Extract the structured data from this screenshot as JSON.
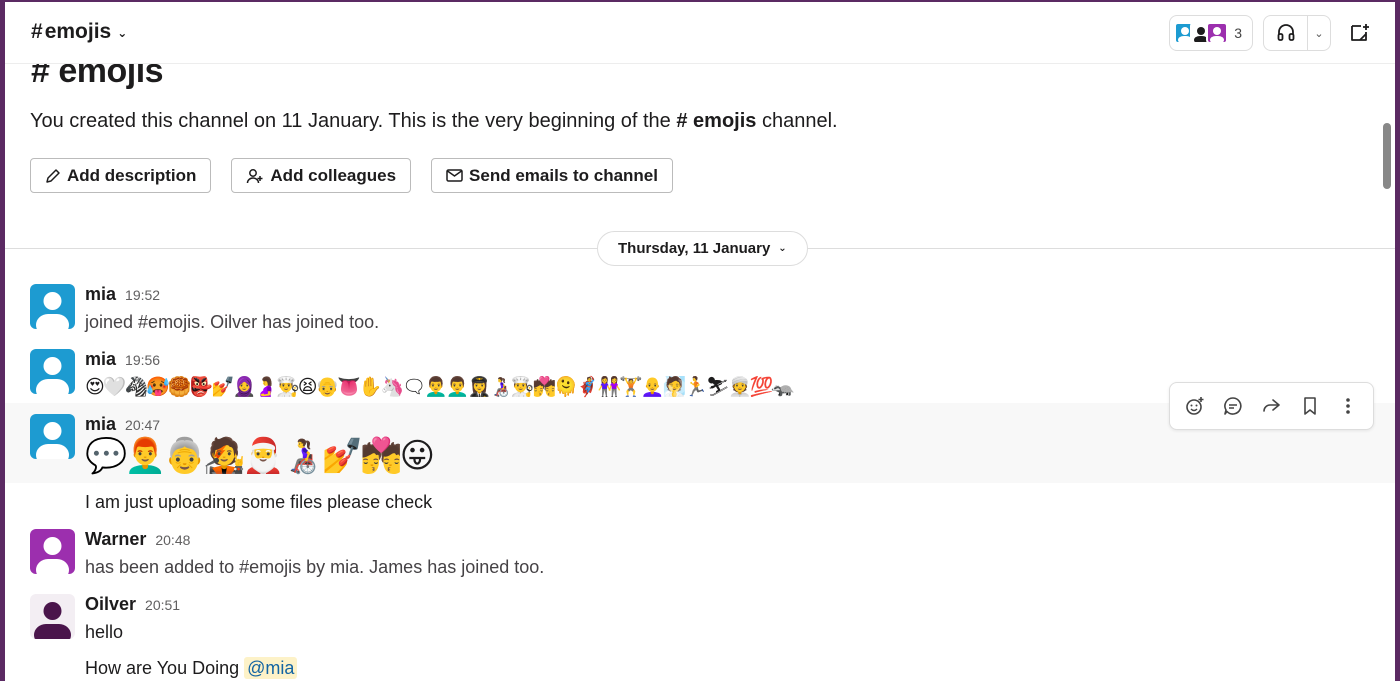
{
  "header": {
    "channel_name": "emojis",
    "hash": "#",
    "member_count": "3"
  },
  "intro": {
    "title": "emojis",
    "hash": "#",
    "text_prefix": "You created this channel on 11 January. This is the very beginning of the ",
    "text_channel": "# emojis",
    "text_suffix": " channel.",
    "buttons": {
      "add_description": "Add description",
      "add_colleagues": "Add colleagues",
      "send_emails": "Send emails to channel"
    }
  },
  "date_divider": "Thursday, 11 January",
  "messages": [
    {
      "author": "mia",
      "time": "19:52",
      "text": "joined #emojis. Oilver has joined too.",
      "avatar_color": "#1d9bd1"
    },
    {
      "author": "mia",
      "time": "19:56",
      "emojis": "😍🤍🦓🥵🥮👺💅🧕🤰👨‍🍳😫👴👅✋🦄🗨👨‍🦱👨‍🦱👩‍✈️👩‍🦽👨‍🍳💏🫠🦸👭🏋️👩‍🦲🧖🏃⛷👳💯🦡",
      "avatar_color": "#1d9bd1"
    },
    {
      "author": "mia",
      "time": "20:47",
      "emojis": "💬👨‍🦰👵🧑‍🎤🎅👩‍🦽💅💏😛",
      "text": "I am just uploading some files please check",
      "avatar_color": "#1d9bd1"
    },
    {
      "author": "Warner",
      "time": "20:48",
      "text": "has been added to #emojis by mia. James has joined too.",
      "avatar_color": "#9c2fae"
    },
    {
      "author": "Oilver",
      "time": "20:51",
      "text": "hello",
      "text2": "How are You Doing",
      "mention": "@mia",
      "avatar_color": "#4a154b"
    }
  ],
  "colors": {
    "frame": "#5b2a63",
    "mention_bg": "#fdf2c8",
    "mention_fg": "#1264a3"
  }
}
